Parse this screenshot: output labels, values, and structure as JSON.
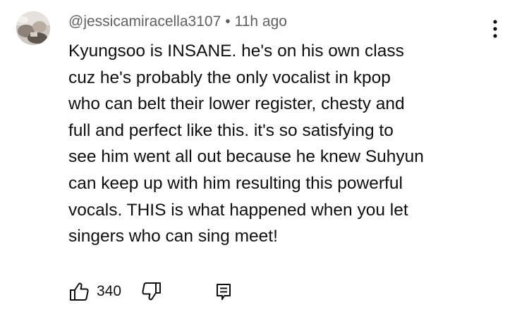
{
  "comment": {
    "author_handle": "@jessicamiracella3107",
    "separator": "•",
    "timestamp": "11h ago",
    "text": "Kyungsoo is INSANE. he's on his own class\ncuz he's probably the only vocalist in kpop\nwho can belt their lower register, chesty and\nfull and perfect like this. it's so satisfying to\nsee him went all out because he knew Suhyun\ncan keep up with him resulting this powerful\nvocals. THIS is what happened when you let\nsingers who can sing meet!",
    "like_count": "340"
  },
  "icons": {
    "avatar": "avatar-photo",
    "more": "vertical-dots-icon",
    "like": "thumbs-up-icon",
    "dislike": "thumbs-down-icon",
    "reply": "reply-comment-icon"
  },
  "colors": {
    "text": "#0f0f0f",
    "meta": "#606060",
    "background": "#ffffff"
  }
}
